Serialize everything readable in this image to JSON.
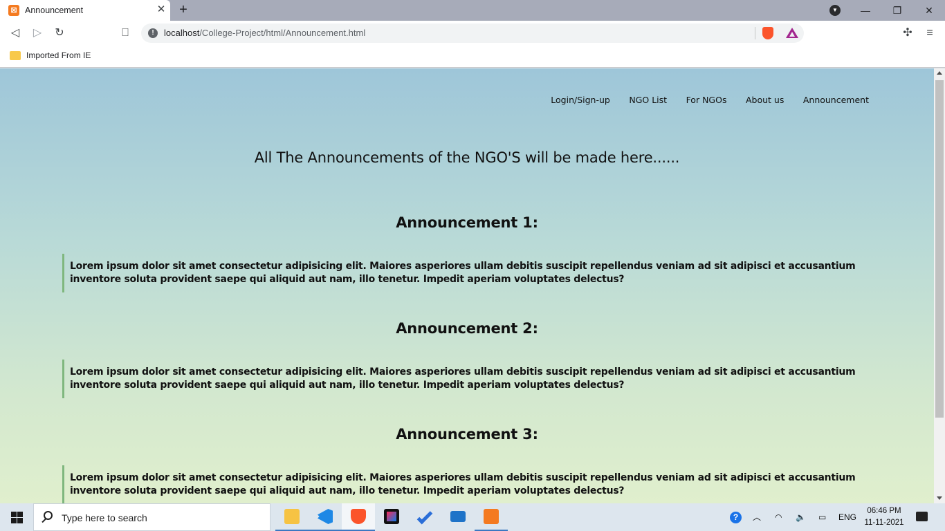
{
  "browser": {
    "tab_title": "Announcement",
    "tab_close": "✕",
    "new_tab": "+",
    "favicon_glyph": "⊠",
    "url_host": "localhost",
    "url_path": "/College-Project/html/Announcement.html",
    "bookmark_folder": "Imported From IE",
    "icons": [
      "back-icon",
      "forward-icon",
      "reload-icon",
      "bookmark-icon",
      "info-icon",
      "brave-shields-icon",
      "brave-rewards-icon",
      "extensions-icon",
      "menu-icon"
    ]
  },
  "nav": {
    "items": [
      "Login/Sign-up",
      "NGO List",
      "For NGOs",
      "About us",
      "Announcement"
    ]
  },
  "page": {
    "heading": "All The Announcements of the NGO'S will be made here......",
    "announcements": [
      {
        "title": "Announcement 1:",
        "body": "Lorem ipsum dolor sit amet consectetur adipisicing elit. Maiores asperiores ullam debitis suscipit repellendus veniam ad sit adipisci et accusantium inventore soluta provident saepe qui aliquid aut nam, illo tenetur. Impedit aperiam voluptates delectus?"
      },
      {
        "title": "Announcement 2:",
        "body": "Lorem ipsum dolor sit amet consectetur adipisicing elit. Maiores asperiores ullam debitis suscipit repellendus veniam ad sit adipisci et accusantium inventore soluta provident saepe qui aliquid aut nam, illo tenetur. Impedit aperiam voluptates delectus?"
      },
      {
        "title": "Announcement 3:",
        "body": "Lorem ipsum dolor sit amet consectetur adipisicing elit. Maiores asperiores ullam debitis suscipit repellendus veniam ad sit adipisci et accusantium inventore soluta provident saepe qui aliquid aut nam, illo tenetur. Impedit aperiam voluptates delectus?"
      }
    ]
  },
  "taskbar": {
    "search_placeholder": "Type here to search",
    "language": "ENG",
    "time": "06:46 PM",
    "date": "11-11-2021"
  },
  "colors": {
    "accent_border": "#7fb77e",
    "page_gradient_top": "#9ec6d9",
    "page_gradient_bottom": "#e0efcd"
  }
}
